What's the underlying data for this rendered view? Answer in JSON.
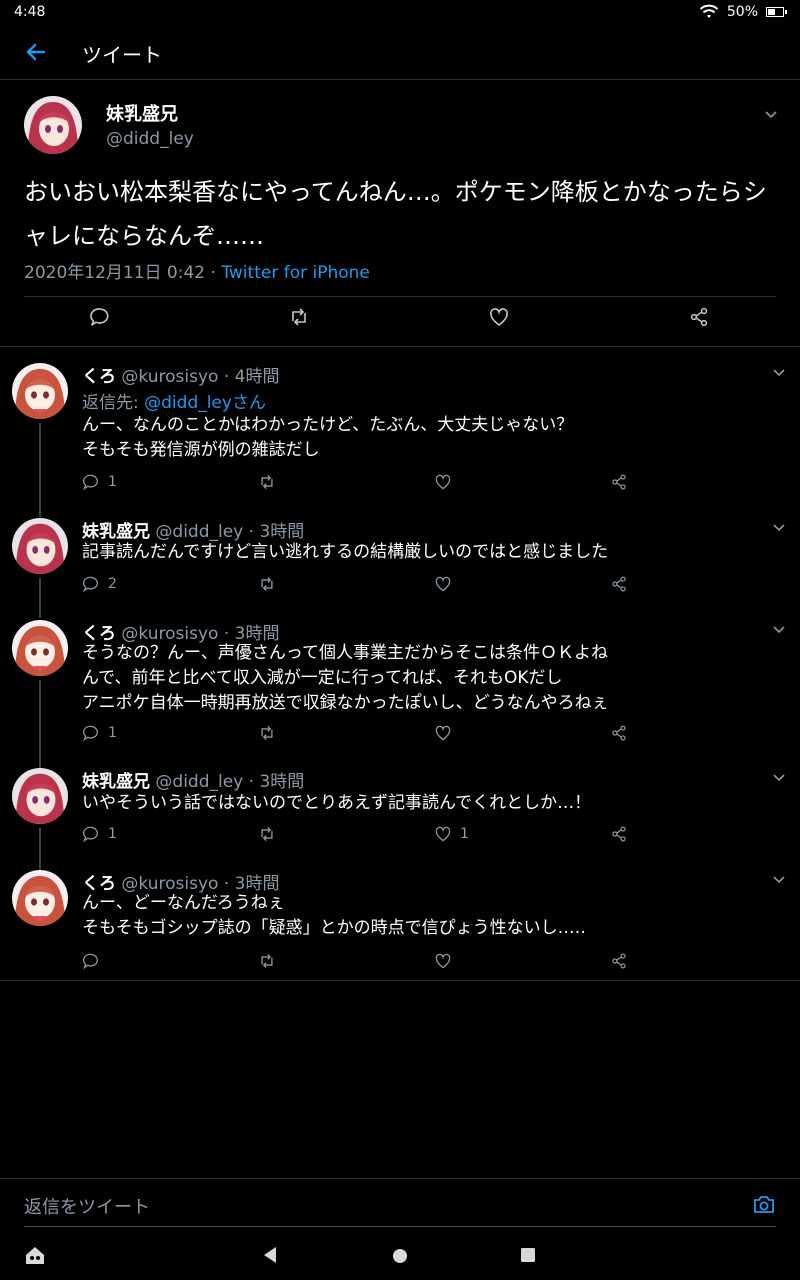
{
  "status_bar": {
    "time": "4:48",
    "battery": "50%"
  },
  "header": {
    "title": "ツイート"
  },
  "main_tweet": {
    "name": "妹乳盛兄",
    "handle": "@didd_ley",
    "text": "おいおい松本梨香なにやってんねん…。ポケモン降板とかなったらシャレにならなんぞ……",
    "date": "2020年12月11日 0:42 · ",
    "source": "Twitter for iPhone"
  },
  "replies": [
    {
      "name": "くろ",
      "meta": "@kurosisyo · 4時間",
      "replying_label": "返信先: ",
      "replying_to": "@didd_leyさん",
      "lines": [
        "んー、なんのことかはわかったけど、たぶん、大丈夫じゃない？",
        "そもそも発信源が例の雑誌だし"
      ],
      "reply_count": "1",
      "like_count": ""
    },
    {
      "name": "妹乳盛兄",
      "meta": "@didd_ley · 3時間",
      "lines": [
        "記事読んだんですけど言い逃れするの結構厳しいのではと感じました"
      ],
      "reply_count": "2",
      "like_count": ""
    },
    {
      "name": "くろ",
      "meta": "@kurosisyo · 3時間",
      "lines": [
        "そうなの？んー、声優さんって個人事業主だからそこは条件ＯＫよね",
        "んで、前年と比べて収入減が一定に行ってれば、それもOKだし",
        "アニポケ自体一時期再放送で収録なかったぽいし、どうなんやろねぇ"
      ],
      "reply_count": "1",
      "like_count": ""
    },
    {
      "name": "妹乳盛兄",
      "meta": "@didd_ley · 3時間",
      "lines": [
        "いやそういう話ではないのでとりあえず記事読んでくれとしか…！"
      ],
      "reply_count": "1",
      "like_count": "1"
    },
    {
      "name": "くろ",
      "meta": "@kurosisyo · 3時間",
      "lines": [
        "んー、どーなんだろうねぇ",
        "そもそもゴシップ誌の「疑惑」とかの時点で信ぴょう性ないし…‥"
      ],
      "reply_count": "",
      "like_count": ""
    }
  ],
  "composer": {
    "placeholder": "返信をツイート"
  },
  "colors": {
    "accent": "#1d9bf0",
    "background": "#000000",
    "secondary_text": "#8b98a5"
  }
}
